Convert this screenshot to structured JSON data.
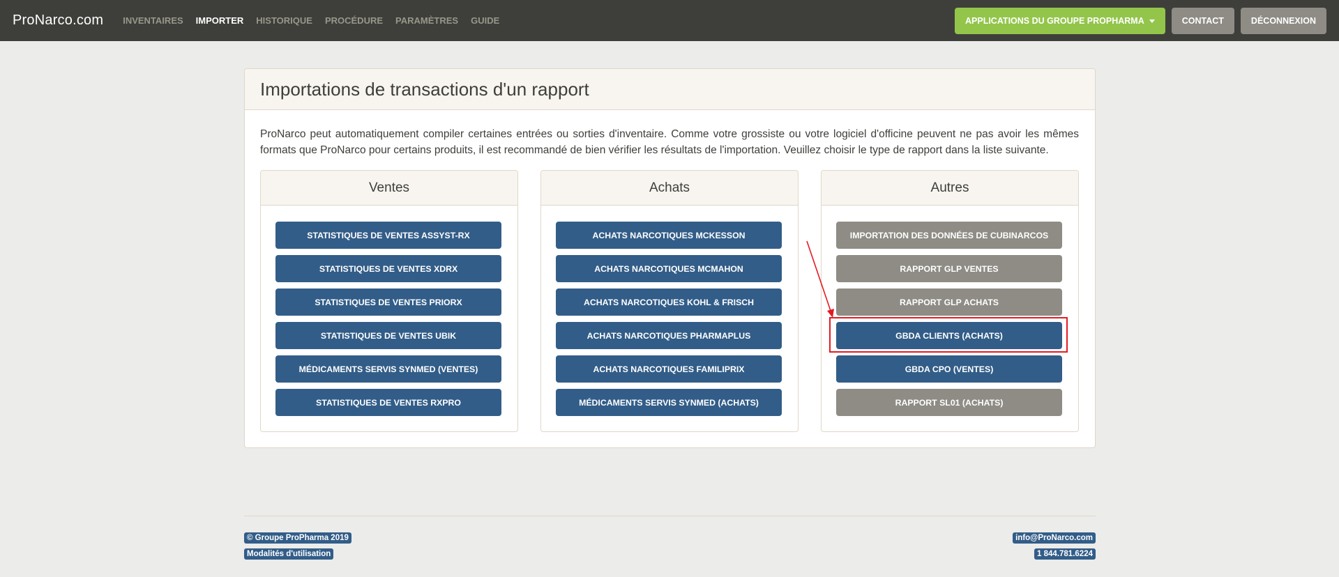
{
  "navbar": {
    "brand": "ProNarco.com",
    "links": [
      "INVENTAIRES",
      "IMPORTER",
      "HISTORIQUE",
      "PROCÉDURE",
      "PARAMÈTRES",
      "GUIDE"
    ],
    "active_link": "IMPORTER",
    "apps_button": "APPLICATIONS DU GROUPE PROPHARMA",
    "contact_button": "CONTACT",
    "logout_button": "DÉCONNEXION"
  },
  "main": {
    "title": "Importations de transactions d'un rapport",
    "intro": "ProNarco peut automatiquement compiler certaines entrées ou sorties d'inventaire. Comme votre grossiste ou votre logiciel d'officine peuvent ne pas avoir les mêmes formats que ProNarco pour certains produits, il est recommandé de bien vérifier les résultats de l'importation. Veuillez choisir le type de rapport dans la liste suivante.",
    "columns": [
      {
        "title": "Ventes",
        "buttons": [
          {
            "label": "STATISTIQUES DE VENTES ASSYST-RX",
            "color": "blue"
          },
          {
            "label": "STATISTIQUES DE VENTES XDRX",
            "color": "blue"
          },
          {
            "label": "STATISTIQUES DE VENTES PRIORX",
            "color": "blue"
          },
          {
            "label": "STATISTIQUES DE VENTES UBIK",
            "color": "blue"
          },
          {
            "label": "MÉDICAMENTS SERVIS SYNMED (VENTES)",
            "color": "blue"
          },
          {
            "label": "STATISTIQUES DE VENTES RXPRO",
            "color": "blue"
          }
        ]
      },
      {
        "title": "Achats",
        "buttons": [
          {
            "label": "ACHATS NARCOTIQUES MCKESSON",
            "color": "blue"
          },
          {
            "label": "ACHATS NARCOTIQUES MCMAHON",
            "color": "blue"
          },
          {
            "label": "ACHATS NARCOTIQUES KOHL & FRISCH",
            "color": "blue"
          },
          {
            "label": "ACHATS NARCOTIQUES PHARMAPLUS",
            "color": "blue"
          },
          {
            "label": "ACHATS NARCOTIQUES FAMILIPRIX",
            "color": "blue"
          },
          {
            "label": "MÉDICAMENTS SERVIS SYNMED (ACHATS)",
            "color": "blue"
          }
        ]
      },
      {
        "title": "Autres",
        "buttons": [
          {
            "label": "IMPORTATION DES DONNÉES DE CUBINARCOS",
            "color": "grey"
          },
          {
            "label": "RAPPORT GLP VENTES",
            "color": "grey"
          },
          {
            "label": "RAPPORT GLP ACHATS",
            "color": "grey"
          },
          {
            "label": "GBDA CLIENTS (ACHATS)",
            "color": "blue",
            "highlighted": true
          },
          {
            "label": "GBDA CPO (VENTES)",
            "color": "blue"
          },
          {
            "label": "RAPPORT SL01 (ACHATS)",
            "color": "grey"
          }
        ]
      }
    ]
  },
  "footer": {
    "copyright": "© Groupe ProPharma 2019",
    "terms": "Modalités d'utilisation",
    "email": "info@ProNarco.com",
    "phone": "1 844.781.6224"
  },
  "colors": {
    "navbar": "#3e3f3a",
    "primary": "#325d88",
    "secondary": "#8e8c84",
    "success": "#93c54b",
    "annotation": "#e21b23"
  }
}
